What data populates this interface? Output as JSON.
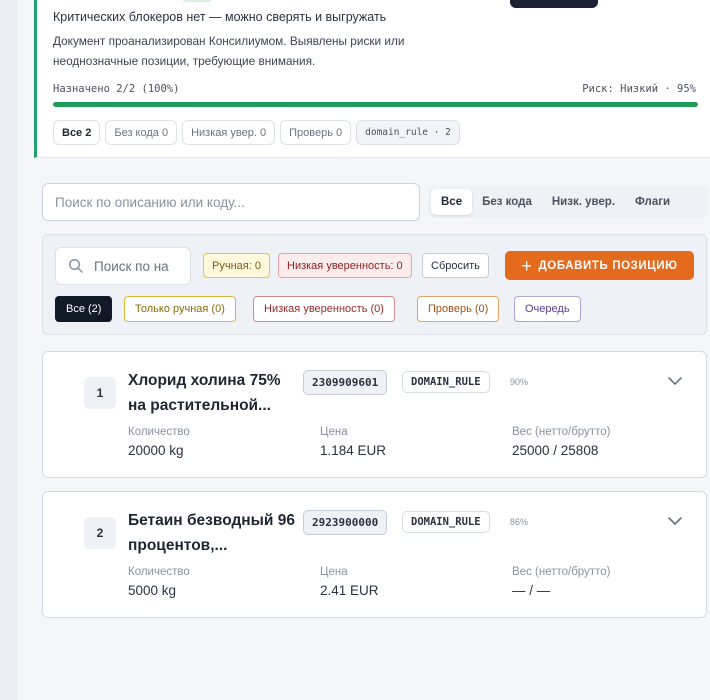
{
  "summary": {
    "headline": "Критических блокеров нет — можно сверять и выгружать",
    "description": "Документ проанализирован Консилиумом. Выявлены риски или неоднозначные позиции, требующие внимания.",
    "assigned": "Назначено 2/2 (100%)",
    "risk": "Риск: Низкий · 95%",
    "progress_percent": 100,
    "progress_color": "#1f9d5a",
    "chips": {
      "all": "Все 2",
      "no_code": "Без кода 0",
      "low_conf": "Низкая увер. 0",
      "check": "Проверь 0",
      "domain_rule": "domain_rule · 2"
    }
  },
  "search": {
    "placeholder": "Поиск по описанию или коду...",
    "tabs": [
      "Все",
      "Без кода",
      "Низк. увер.",
      "Флаги"
    ],
    "active_tab": "Все"
  },
  "filters": {
    "search_placeholder": "Поиск по на",
    "search_icon": "search-icon",
    "manual_tag": "Ручная: 0",
    "low_conf_tag": "Низкая уверенность: 0",
    "reset_label": "Сбросить",
    "add_label": "ДОБАВИТЬ ПОЗИЦИЮ",
    "add_color": "#e46a1e",
    "chips": {
      "all": "Все (2)",
      "manual_only": "Только ручная (0)",
      "low_conf": "Низкая уверенность (0)",
      "check": "Проверь (0)",
      "queue": "Очередь"
    }
  },
  "fields": {
    "qty_label": "Количество",
    "price_label": "Цена",
    "weight_label": "Вес (нетто/брутто)"
  },
  "items": [
    {
      "num": "1",
      "name": "Хлорид холина 75% на растительной...",
      "code": "2309909601",
      "rule": "DOMAIN_RULE",
      "confidence": "90%",
      "qty": "20000 kg",
      "price": "1.184 EUR",
      "weight": "25000 / 25808"
    },
    {
      "num": "2",
      "name": "Бетаин безводный 96 процентов,...",
      "code": "2923900000",
      "rule": "DOMAIN_RULE",
      "confidence": "86%",
      "qty": "5000 kg",
      "price": "2.41 EUR",
      "weight": "— / —"
    }
  ]
}
